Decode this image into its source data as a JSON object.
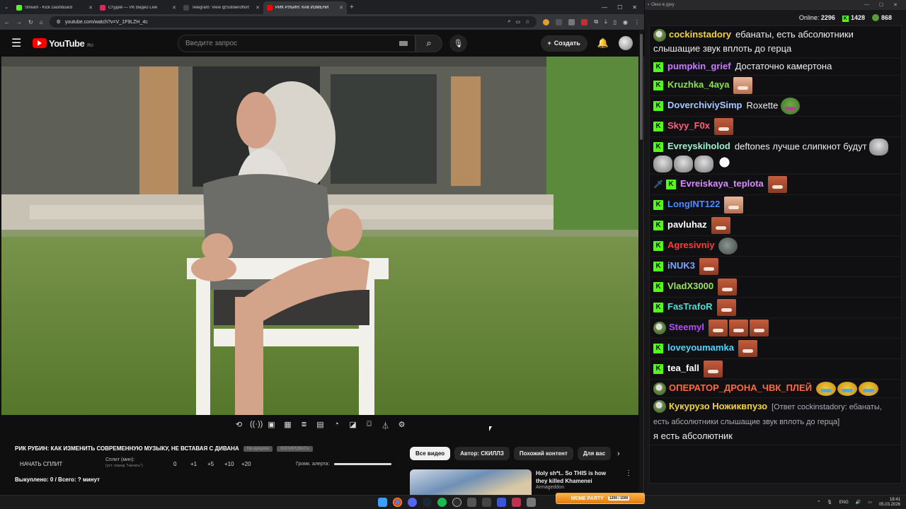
{
  "browser": {
    "tabs": [
      {
        "title": "Stream - Kick Dashboard",
        "color": "#53fc18",
        "active": false
      },
      {
        "title": "Студия — VK Видео Live",
        "color": "#e0245e",
        "active": false
      },
      {
        "title": "Telegram: View @Soldieroffort",
        "color": "#444444",
        "active": false
      },
      {
        "title": "РИК РУБИН: КАК ИЗМЕНИ",
        "color": "#ff0000",
        "active": true
      }
    ],
    "url": "youtube.com/watch?v=V_1F9LZH_4c"
  },
  "youtube": {
    "logo_text": "YouTube",
    "region": "RU",
    "search_placeholder": "Введите запрос",
    "create_label": "Создать"
  },
  "below": {
    "title": "РИК РУБИН: КАК ИЗМЕНИТЬ СОВРЕМЕННУЮ МУЗЫКУ, НЕ ВСТАВАЯ С ДИВАНА",
    "chip1": "На аукцион",
    "chip2": "КОПИРОВАТЬ",
    "split_start": "НАЧАТЬ СПЛИТ",
    "split_min": "Сплит (мин):",
    "split_hint": "(уст. перед \"Начать\")",
    "nums": [
      "0",
      "+1",
      "+5",
      "+10",
      "+20"
    ],
    "alert_label": "Громк. алерта:",
    "alert_level": 1.0,
    "bought": "Выкуплено: 0 / Всего: ? минут",
    "chips": [
      "Все видео",
      "Автор: СКИЛЛЗ",
      "Похожий контент",
      "Для вас"
    ],
    "rec_title": "Holy sh*t.. So THIS is how they killed Khamenei",
    "rec_author": "Armageddon"
  },
  "chat": {
    "window_title": "Окно в дуку",
    "online_label": "Online:",
    "online": "2296",
    "kick_count": "1428",
    "other_count": "868",
    "messages": [
      {
        "badge": "pepe",
        "user": "cockinstadory",
        "color": "#f5d33c",
        "text": "ебанаты, есть абсолютники слышащие звук вплоть до герца"
      },
      {
        "badge": "K",
        "user": "pumpkin_grief",
        "color": "#c77dff",
        "text": "Достаточно камертона"
      },
      {
        "badge": "K",
        "user": "Kruzhka_4aya",
        "color": "#8be04e",
        "text": ""
      },
      {
        "badge": "K",
        "user": "DoverchiviySimp",
        "color": "#a8c9ff",
        "text": "Roxette"
      },
      {
        "badge": "K",
        "user": "Skyy_F0x",
        "color": "#ff5e7e",
        "text": ""
      },
      {
        "badge": "K",
        "user": "Evreyskiholod",
        "color": "#9ef0d0",
        "text": "deftones лучше слипкнот будут"
      },
      {
        "badge": "K",
        "user": "Evreiskaya_teplota",
        "color": "#d98cff",
        "text": ""
      },
      {
        "badge": "K",
        "user": "LongINT122",
        "color": "#4a8cff",
        "text": ""
      },
      {
        "badge": "K",
        "user": "pavluhaz",
        "color": "#ffffff",
        "text": ""
      },
      {
        "badge": "K",
        "user": "Agresivniy",
        "color": "#ff3b3b",
        "text": ""
      },
      {
        "badge": "K",
        "user": "iNUK3",
        "color": "#7aa7ff",
        "text": ""
      },
      {
        "badge": "K",
        "user": "VladX3000",
        "color": "#9be35f",
        "text": ""
      },
      {
        "badge": "K",
        "user": "FasTrafoR",
        "color": "#4be0d2",
        "text": ""
      },
      {
        "badge": "pepe",
        "user": "Steemyl",
        "color": "#b44bff",
        "text": ""
      },
      {
        "badge": "K",
        "user": "loveyoumamka",
        "color": "#4fd4ff",
        "text": ""
      },
      {
        "badge": "K",
        "user": "tea_fall",
        "color": "#ffffff",
        "text": ""
      },
      {
        "badge": "pepe",
        "user": "ОПЕРАТОР_ДРОНА_ЧВК_ПЛЕЙ",
        "color": "#ff6a3d",
        "text": ""
      },
      {
        "badge": "pepe",
        "user": "Кукурузо Ножиквпузо",
        "color": "#f5d33c",
        "reply": "[Ответ cockinstadory: ебанаты, есть абсолютники слышащие звук вплоть до герца]",
        "text": "я есть абсолютник"
      }
    ]
  },
  "taskbar": {
    "meme_label": "MEME PARTY",
    "meme_sub": "1200 / 1500",
    "lang": "ENG",
    "time": "18:41",
    "date": "05.03.2026"
  }
}
